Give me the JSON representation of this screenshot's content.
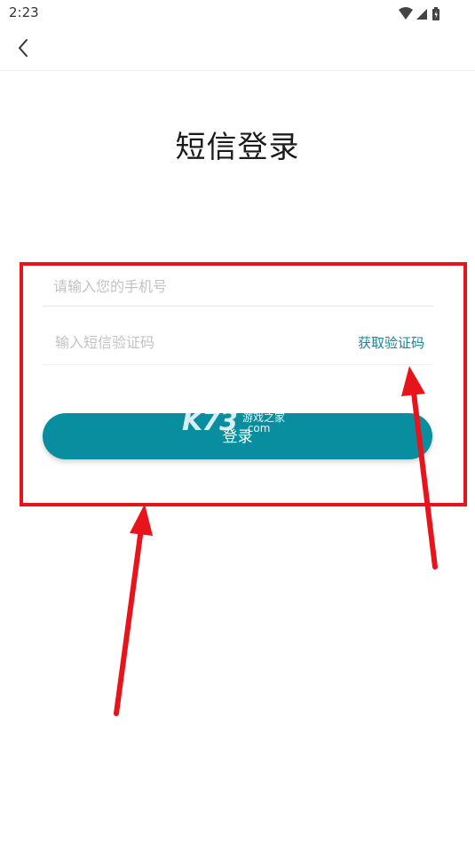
{
  "status_bar": {
    "time": "2:23",
    "icons": [
      "wifi-icon",
      "signal-icon",
      "battery-icon"
    ]
  },
  "nav": {
    "back_icon": "chevron-left-icon"
  },
  "title": "短信登录",
  "form": {
    "phone_placeholder": "请输入您的手机号",
    "phone_value": "",
    "code_placeholder": "输入短信验证码",
    "code_value": "",
    "get_code_label": "获取验证码",
    "login_label": "登录"
  },
  "watermark": {
    "big": "K73",
    "top": "游戏之家",
    "bottom": ".com"
  },
  "colors": {
    "accent": "#098ea0",
    "link": "#128898",
    "annotation": "#e8141c"
  }
}
